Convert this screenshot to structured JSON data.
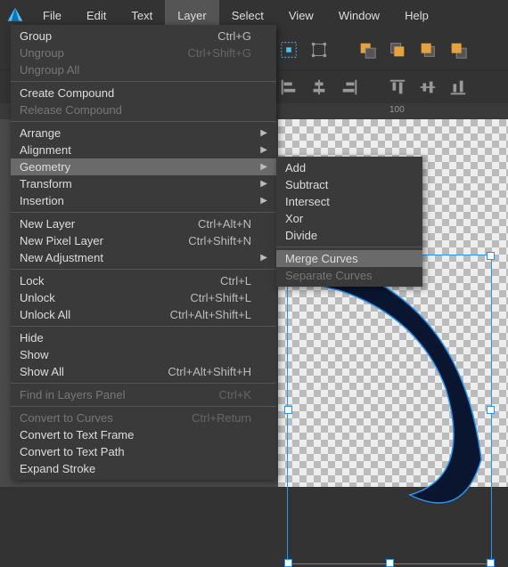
{
  "menubar": {
    "items": [
      "File",
      "Edit",
      "Text",
      "Layer",
      "Select",
      "View",
      "Window",
      "Help"
    ],
    "active_index": 3
  },
  "ruler": {
    "tick_label": "100"
  },
  "dropdown": {
    "items": [
      {
        "label": "Group",
        "shortcut": "Ctrl+G",
        "enabled": true
      },
      {
        "label": "Ungroup",
        "shortcut": "Ctrl+Shift+G",
        "enabled": false
      },
      {
        "label": "Ungroup All",
        "shortcut": "",
        "enabled": false
      },
      {
        "sep": true
      },
      {
        "label": "Create Compound",
        "shortcut": "",
        "enabled": true
      },
      {
        "label": "Release Compound",
        "shortcut": "",
        "enabled": false
      },
      {
        "sep": true
      },
      {
        "label": "Arrange",
        "shortcut": "",
        "enabled": true,
        "submenu": true
      },
      {
        "label": "Alignment",
        "shortcut": "",
        "enabled": true,
        "submenu": true
      },
      {
        "label": "Geometry",
        "shortcut": "",
        "enabled": true,
        "submenu": true,
        "highlight": true
      },
      {
        "label": "Transform",
        "shortcut": "",
        "enabled": true,
        "submenu": true
      },
      {
        "label": "Insertion",
        "shortcut": "",
        "enabled": true,
        "submenu": true
      },
      {
        "sep": true
      },
      {
        "label": "New Layer",
        "shortcut": "Ctrl+Alt+N",
        "enabled": true
      },
      {
        "label": "New Pixel Layer",
        "shortcut": "Ctrl+Shift+N",
        "enabled": true
      },
      {
        "label": "New Adjustment",
        "shortcut": "",
        "enabled": true,
        "submenu": true
      },
      {
        "sep": true
      },
      {
        "label": "Lock",
        "shortcut": "Ctrl+L",
        "enabled": true
      },
      {
        "label": "Unlock",
        "shortcut": "Ctrl+Shift+L",
        "enabled": true
      },
      {
        "label": "Unlock All",
        "shortcut": "Ctrl+Alt+Shift+L",
        "enabled": true
      },
      {
        "sep": true
      },
      {
        "label": "Hide",
        "shortcut": "",
        "enabled": true
      },
      {
        "label": "Show",
        "shortcut": "",
        "enabled": true
      },
      {
        "label": "Show All",
        "shortcut": "Ctrl+Alt+Shift+H",
        "enabled": true
      },
      {
        "sep": true
      },
      {
        "label": "Find in Layers Panel",
        "shortcut": "Ctrl+K",
        "enabled": false
      },
      {
        "sep": true
      },
      {
        "label": "Convert to Curves",
        "shortcut": "Ctrl+Return",
        "enabled": false
      },
      {
        "label": "Convert to Text Frame",
        "shortcut": "",
        "enabled": true
      },
      {
        "label": "Convert to Text Path",
        "shortcut": "",
        "enabled": true
      },
      {
        "label": "Expand Stroke",
        "shortcut": "",
        "enabled": true
      }
    ]
  },
  "submenu": {
    "items": [
      {
        "label": "Add",
        "enabled": true
      },
      {
        "label": "Subtract",
        "enabled": true
      },
      {
        "label": "Intersect",
        "enabled": true
      },
      {
        "label": "Xor",
        "enabled": true
      },
      {
        "label": "Divide",
        "enabled": true
      },
      {
        "sep": true
      },
      {
        "label": "Merge Curves",
        "enabled": true,
        "highlight": true
      },
      {
        "label": "Separate Curves",
        "enabled": false
      }
    ]
  }
}
